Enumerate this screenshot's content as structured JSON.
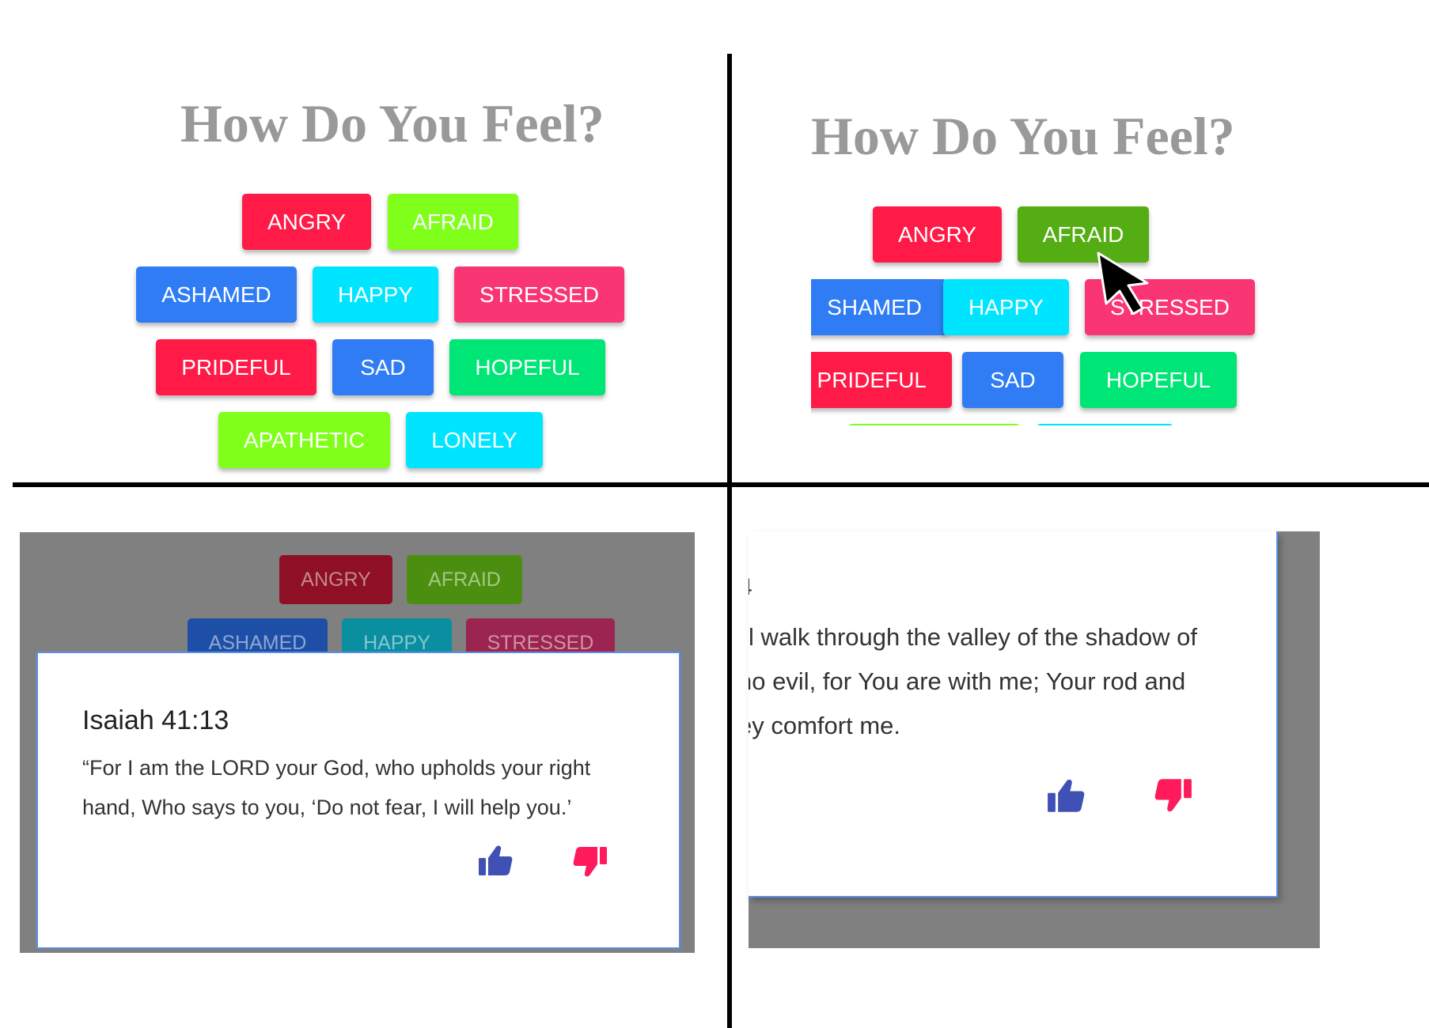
{
  "title": "How Do You Feel?",
  "emotions": [
    "ANGRY",
    "AFRAID",
    "ASHAMED",
    "HAPPY",
    "STRESSED",
    "PRIDEFUL",
    "SAD",
    "HOPEFUL",
    "APATHETIC",
    "LONELY"
  ],
  "partial_labels": {
    "ashamed_cut": "SHAMED",
    "stressed_cut": "STRESSED"
  },
  "modal": {
    "reference": "Isaiah 41:13",
    "text": "“For I am the LORD your God, who upholds your right hand, Who says to you, ‘Do not fear, I will help you.’"
  },
  "second_modal": {
    "cut_glyph": "4",
    "lines": [
      "l walk through the valley of the shadow of",
      "no evil, for You are with me; Your rod and",
      "ey comfort me."
    ]
  },
  "icons": {
    "like": "thumbs-up-icon",
    "dislike": "thumbs-down-icon",
    "cursor": "mouse-cursor-icon"
  },
  "colors": {
    "angry": "#ff1a47",
    "afraid": "#7fff1a",
    "afraid_hover": "#54ad12",
    "ashamed": "#2f7cf5",
    "happy": "#00e5ff",
    "stressed": "#f93673",
    "prideful": "#ff1a47",
    "sad": "#2f7cf5",
    "hopeful": "#00e676",
    "apathetic": "#7fff1a",
    "lonely": "#00e5ff",
    "title": "#999999",
    "overlay": "#808080",
    "like": "#3f51b5",
    "dislike": "#ff1a5b"
  }
}
